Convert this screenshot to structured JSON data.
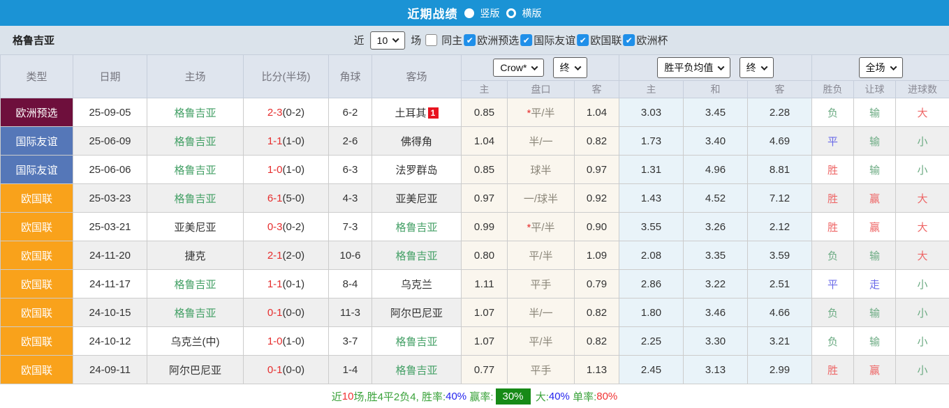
{
  "title_bar": {
    "title": "近期战绩",
    "vertical_label": "竖版",
    "horizontal_label": "横版",
    "selected_layout": "竖版"
  },
  "filter_bar": {
    "team": "格鲁吉亚",
    "recent_label": "近",
    "recent_count": "10",
    "recent_suffix": "场",
    "same_home_label": "同主",
    "same_home_checked": false,
    "leagues": [
      {
        "label": "欧洲预选",
        "checked": true
      },
      {
        "label": "国际友谊",
        "checked": true
      },
      {
        "label": "欧国联",
        "checked": true
      },
      {
        "label": "欧洲杯",
        "checked": true
      }
    ]
  },
  "selects": {
    "bookmaker": "Crow*",
    "odds_period": "终",
    "avg_type": "胜平负均值",
    "avg_period": "终",
    "scope": "全场"
  },
  "table": {
    "left_headers": [
      "类型",
      "日期",
      "主场",
      "比分(半场)",
      "角球",
      "客场"
    ],
    "sub_headers": [
      "主",
      "盘口",
      "客",
      "主",
      "和",
      "客",
      "胜负",
      "让球",
      "进球数"
    ],
    "rows": [
      {
        "type": "欧洲预选",
        "type_style": "maroon",
        "date": "25-09-05",
        "home": "格鲁吉亚",
        "home_team": true,
        "score": "2-3",
        "half": "(0-2)",
        "corners": "6-2",
        "away": "土耳其",
        "away_team": false,
        "away_badge": "1",
        "o_home": "0.85",
        "handicap": "平/半",
        "handicap_star": true,
        "o_away": "1.04",
        "avg_home": "3.03",
        "avg_draw": "3.45",
        "avg_away": "2.28",
        "res": "负",
        "res_style": "green",
        "let": "输",
        "let_style": "green",
        "goals": "大",
        "goals_style": "red"
      },
      {
        "type": "国际友谊",
        "type_style": "blue",
        "date": "25-06-09",
        "home": "格鲁吉亚",
        "home_team": true,
        "score": "1-1",
        "half": "(1-0)",
        "corners": "2-6",
        "away": "佛得角",
        "away_team": false,
        "away_badge": "",
        "o_home": "1.04",
        "handicap": "半/一",
        "handicap_star": false,
        "o_away": "0.82",
        "avg_home": "1.73",
        "avg_draw": "3.40",
        "avg_away": "4.69",
        "res": "平",
        "res_style": "blue",
        "let": "输",
        "let_style": "green",
        "goals": "小",
        "goals_style": "green"
      },
      {
        "type": "国际友谊",
        "type_style": "blue",
        "date": "25-06-06",
        "home": "格鲁吉亚",
        "home_team": true,
        "score": "1-0",
        "half": "(1-0)",
        "corners": "6-3",
        "away": "法罗群岛",
        "away_team": false,
        "away_badge": "",
        "o_home": "0.85",
        "handicap": "球半",
        "handicap_star": false,
        "o_away": "0.97",
        "avg_home": "1.31",
        "avg_draw": "4.96",
        "avg_away": "8.81",
        "res": "胜",
        "res_style": "red",
        "let": "输",
        "let_style": "green",
        "goals": "小",
        "goals_style": "green"
      },
      {
        "type": "欧国联",
        "type_style": "orange",
        "date": "25-03-23",
        "home": "格鲁吉亚",
        "home_team": true,
        "score": "6-1",
        "half": "(5-0)",
        "corners": "4-3",
        "away": "亚美尼亚",
        "away_team": false,
        "away_badge": "",
        "o_home": "0.97",
        "handicap": "一/球半",
        "handicap_star": false,
        "o_away": "0.92",
        "avg_home": "1.43",
        "avg_draw": "4.52",
        "avg_away": "7.12",
        "res": "胜",
        "res_style": "red",
        "let": "赢",
        "let_style": "red",
        "goals": "大",
        "goals_style": "red"
      },
      {
        "type": "欧国联",
        "type_style": "orange",
        "date": "25-03-21",
        "home": "亚美尼亚",
        "home_team": false,
        "score": "0-3",
        "half": "(0-2)",
        "corners": "7-3",
        "away": "格鲁吉亚",
        "away_team": true,
        "away_badge": "",
        "o_home": "0.99",
        "handicap": "平/半",
        "handicap_star": true,
        "o_away": "0.90",
        "avg_home": "3.55",
        "avg_draw": "3.26",
        "avg_away": "2.12",
        "res": "胜",
        "res_style": "red",
        "let": "赢",
        "let_style": "red",
        "goals": "大",
        "goals_style": "red"
      },
      {
        "type": "欧国联",
        "type_style": "orange",
        "date": "24-11-20",
        "home": "捷克",
        "home_team": false,
        "score": "2-1",
        "half": "(2-0)",
        "corners": "10-6",
        "away": "格鲁吉亚",
        "away_team": true,
        "away_badge": "",
        "o_home": "0.80",
        "handicap": "平/半",
        "handicap_star": false,
        "o_away": "1.09",
        "avg_home": "2.08",
        "avg_draw": "3.35",
        "avg_away": "3.59",
        "res": "负",
        "res_style": "green",
        "let": "输",
        "let_style": "green",
        "goals": "大",
        "goals_style": "red"
      },
      {
        "type": "欧国联",
        "type_style": "orange",
        "date": "24-11-17",
        "home": "格鲁吉亚",
        "home_team": true,
        "score": "1-1",
        "half": "(0-1)",
        "corners": "8-4",
        "away": "乌克兰",
        "away_team": false,
        "away_badge": "",
        "o_home": "1.11",
        "handicap": "平手",
        "handicap_star": false,
        "o_away": "0.79",
        "avg_home": "2.86",
        "avg_draw": "3.22",
        "avg_away": "2.51",
        "res": "平",
        "res_style": "blue",
        "let": "走",
        "let_style": "blue",
        "goals": "小",
        "goals_style": "green"
      },
      {
        "type": "欧国联",
        "type_style": "orange",
        "date": "24-10-15",
        "home": "格鲁吉亚",
        "home_team": true,
        "score": "0-1",
        "half": "(0-0)",
        "corners": "11-3",
        "away": "阿尔巴尼亚",
        "away_team": false,
        "away_badge": "",
        "o_home": "1.07",
        "handicap": "半/一",
        "handicap_star": false,
        "o_away": "0.82",
        "avg_home": "1.80",
        "avg_draw": "3.46",
        "avg_away": "4.66",
        "res": "负",
        "res_style": "green",
        "let": "输",
        "let_style": "green",
        "goals": "小",
        "goals_style": "green"
      },
      {
        "type": "欧国联",
        "type_style": "orange",
        "date": "24-10-12",
        "home": "乌克兰(中)",
        "home_team": false,
        "score": "1-0",
        "half": "(1-0)",
        "corners": "3-7",
        "away": "格鲁吉亚",
        "away_team": true,
        "away_badge": "",
        "o_home": "1.07",
        "handicap": "平/半",
        "handicap_star": false,
        "o_away": "0.82",
        "avg_home": "2.25",
        "avg_draw": "3.30",
        "avg_away": "3.21",
        "res": "负",
        "res_style": "green",
        "let": "输",
        "let_style": "green",
        "goals": "小",
        "goals_style": "green"
      },
      {
        "type": "欧国联",
        "type_style": "orange",
        "date": "24-09-11",
        "home": "阿尔巴尼亚",
        "home_team": false,
        "score": "0-1",
        "half": "(0-0)",
        "corners": "1-4",
        "away": "格鲁吉亚",
        "away_team": true,
        "away_badge": "",
        "o_home": "0.77",
        "handicap": "平手",
        "handicap_star": false,
        "o_away": "1.13",
        "avg_home": "2.45",
        "avg_draw": "3.13",
        "avg_away": "2.99",
        "res": "胜",
        "res_style": "red",
        "let": "赢",
        "let_style": "red",
        "goals": "小",
        "goals_style": "green"
      }
    ]
  },
  "summary": {
    "segments": [
      {
        "text": "近",
        "style": "green"
      },
      {
        "text": "10",
        "style": "red"
      },
      {
        "text": "场,胜4平2负4, ",
        "style": "green"
      },
      {
        "text": "胜率:",
        "style": "green"
      },
      {
        "text": "40%",
        "style": "blue"
      },
      {
        "text": " 赢率:",
        "style": "green"
      },
      {
        "text": "30%",
        "style": "greenbox"
      },
      {
        "text": " 大:",
        "style": "green"
      },
      {
        "text": "40%",
        "style": "blue"
      },
      {
        "text": " 单率:",
        "style": "green"
      },
      {
        "text": "80%",
        "style": "red"
      }
    ]
  },
  "colors": {
    "topbar_blue": "#1b93d5",
    "filterbar_bg": "#dbe3eb",
    "header_bg": "#dfe5ee",
    "type_maroon": "#6e0f3c",
    "type_blue": "#5577b8",
    "type_orange": "#f9a21b",
    "team_green": "#44a066",
    "score_red": "#e62e2e",
    "result_red": "#ee6666",
    "result_green": "#6cab83",
    "result_blue": "#6a6ae8",
    "odds_cream_bg": "#faf6ee",
    "avg_blue_bg": "#e9f3f9",
    "summary_box_green": "#178a17",
    "badge_red": "#e8121f"
  }
}
